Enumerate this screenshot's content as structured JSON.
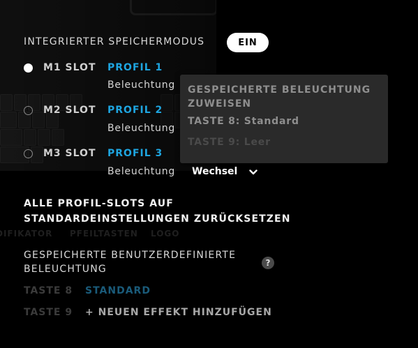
{
  "background": {
    "tabs": [
      "DIFIKATOR",
      "PFEILTASTEN",
      "LOGO"
    ]
  },
  "memory_mode": {
    "title": "INTEGRIERTER SPEICHERMODUS",
    "toggle_label": "EIN"
  },
  "slots": [
    {
      "slot": "M1 SLOT",
      "selected": true,
      "profile": "PROFIL 1",
      "lighting_label": "Beleuchtung",
      "lighting_value": ""
    },
    {
      "slot": "M2 SLOT",
      "selected": false,
      "profile": "PROFIL 2",
      "lighting_label": "Beleuchtung",
      "lighting_value": ""
    },
    {
      "slot": "M3 SLOT",
      "selected": false,
      "profile": "PROFIL 3",
      "lighting_label": "Beleuchtung",
      "lighting_value": "Wechsel"
    }
  ],
  "dropdown": {
    "header": "GESPEICHERTE BELEUCHTUNG ZUWEISEN",
    "options": [
      "TASTE 8: Standard",
      "TASTE 9: Leer"
    ]
  },
  "reset_all": "ALLE PROFIL-SLOTS AUF STANDARDEINSTELLUNGEN ZURÜCKSETZEN",
  "saved_lighting": {
    "title": "GESPEICHERTE BENUTZERDEFINIERTE BELEUCHTUNG",
    "help": "?",
    "keys": [
      {
        "key": "TASTE 8",
        "value": "STANDARD"
      },
      {
        "key": "TASTE 9",
        "value": "+ NEUEN EFFEKT HINZUFÜGEN"
      }
    ]
  },
  "colors": {
    "accent": "#1ea5e0",
    "background": "#000000",
    "dropdown_bg": "#2a2a2a"
  }
}
